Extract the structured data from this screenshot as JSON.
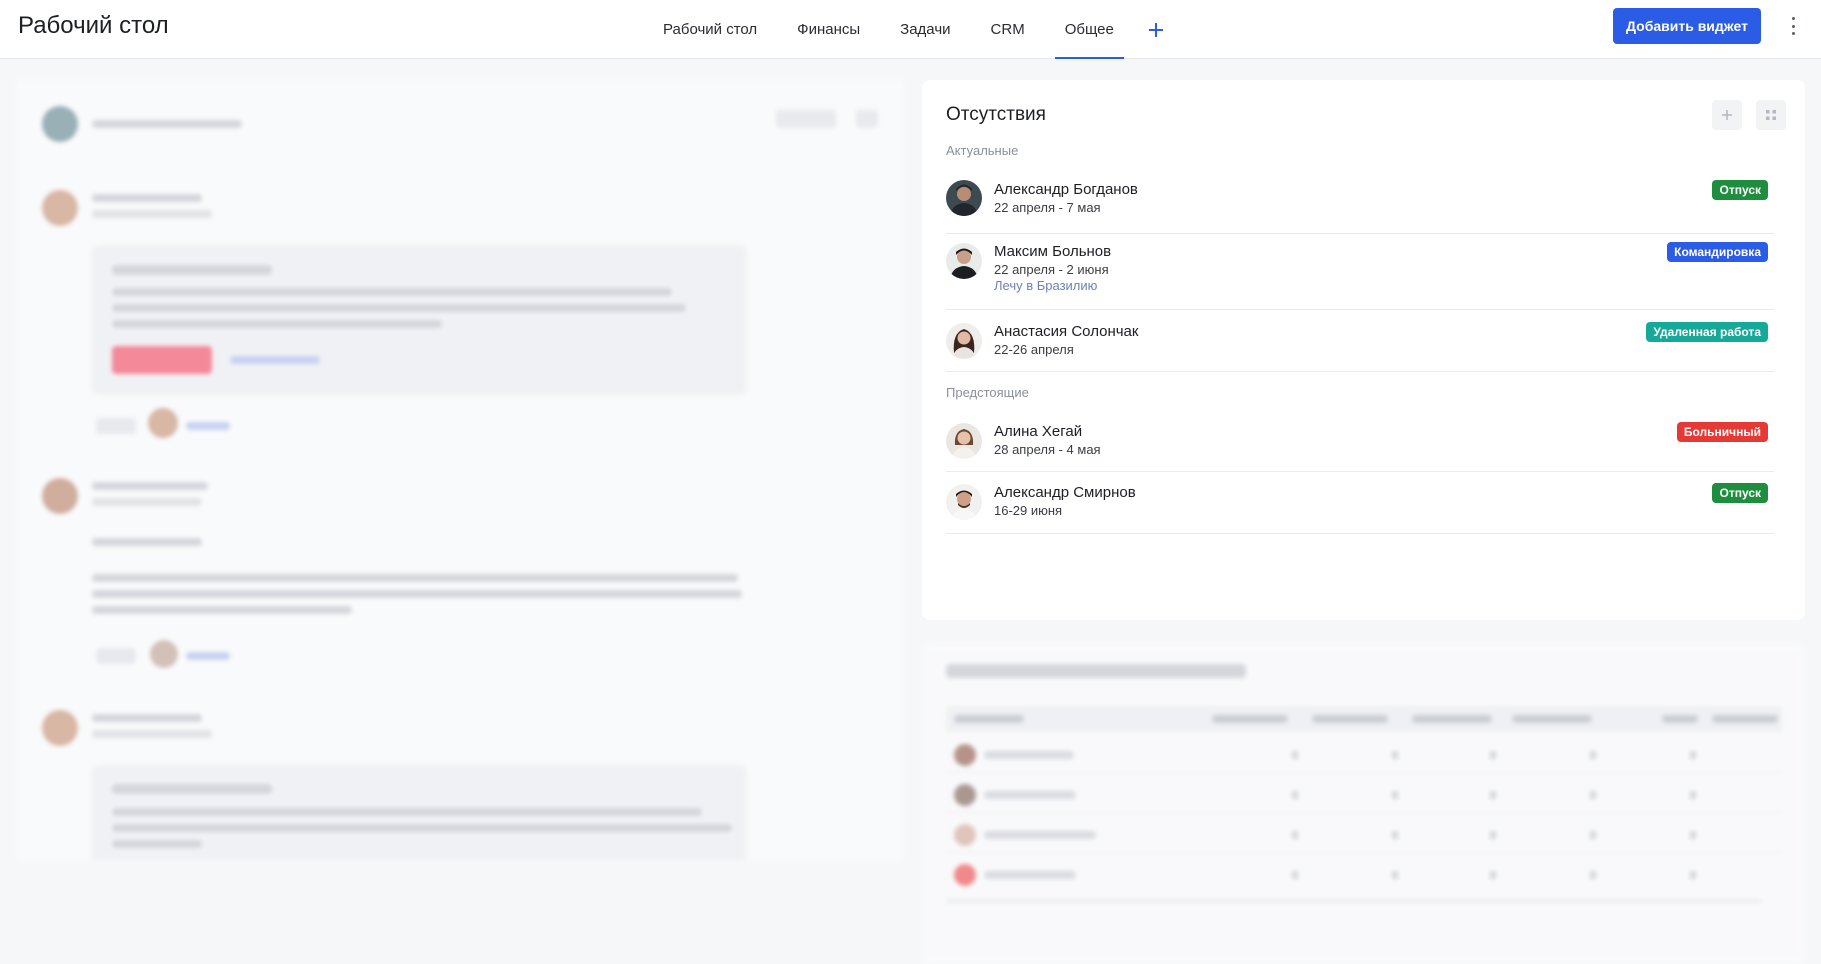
{
  "header": {
    "title": "Рабочий стол",
    "tabs": [
      {
        "label": "Рабочий стол",
        "active": false
      },
      {
        "label": "Финансы",
        "active": false
      },
      {
        "label": "Задачи",
        "active": false
      },
      {
        "label": "CRM",
        "active": false
      },
      {
        "label": "Общее",
        "active": true
      }
    ],
    "add_tab_icon": "plus-icon",
    "add_widget_label": "Добавить виджет",
    "menu_icon": "kebab-menu-icon",
    "accent_color": "#2b5ce6"
  },
  "absences": {
    "title": "Отсутствия",
    "add_icon": "plus-icon",
    "grid_icon": "grid-icon",
    "sections": [
      {
        "label": "Актуальные",
        "items": [
          {
            "name": "Александр Богданов",
            "dates": "22 апреля - 7 мая",
            "note": "",
            "badge": "Отпуск",
            "badge_color": "#1e8e3e"
          },
          {
            "name": "Максим Больнов",
            "dates": "22 апреля - 2 июня",
            "note": "Лечу в Бразилию",
            "badge": "Командировка",
            "badge_color": "#2b5ce6"
          },
          {
            "name": "Анастасия Солончак",
            "dates": "22-26 апреля",
            "note": "",
            "badge": "Удаленная работа",
            "badge_color": "#16a99a"
          }
        ]
      },
      {
        "label": "Предстоящие",
        "items": [
          {
            "name": "Алина Хегай",
            "dates": "28 апреля - 4 мая",
            "note": "",
            "badge": "Больничный",
            "badge_color": "#e53935"
          },
          {
            "name": "Александр Смирнов",
            "dates": "16-29 июня",
            "note": "",
            "badge": "Отпуск",
            "badge_color": "#1e8e3e"
          }
        ]
      }
    ]
  }
}
